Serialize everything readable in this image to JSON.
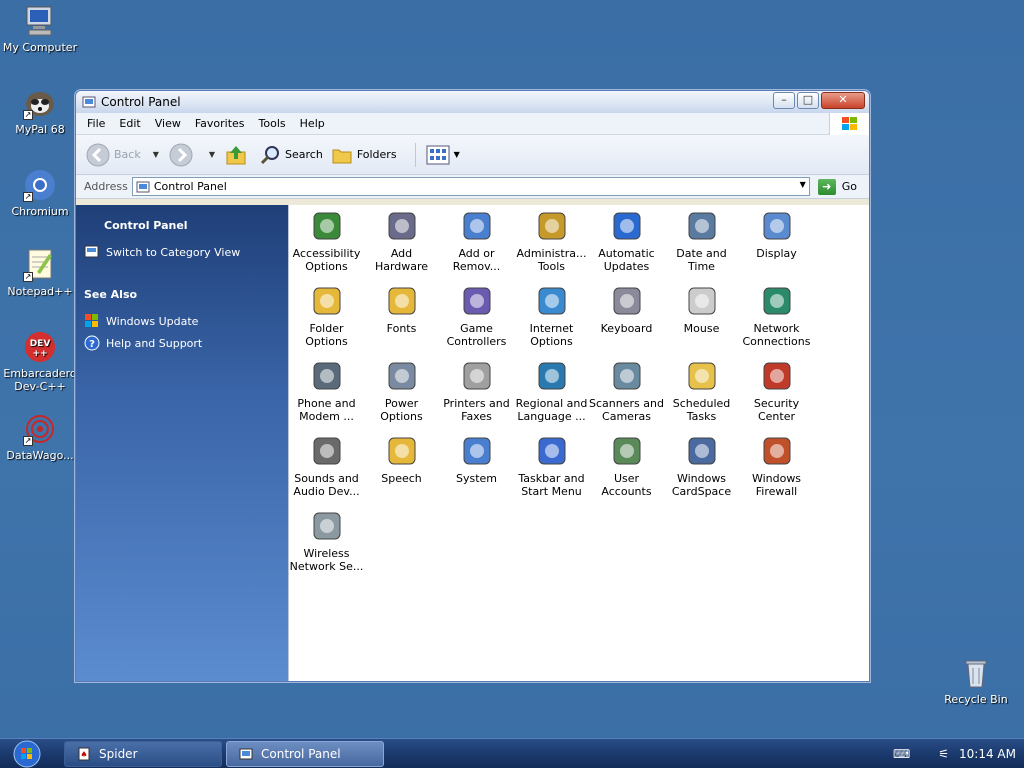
{
  "desktop": {
    "icons": [
      {
        "label": "My Computer",
        "icon": "my-computer-icon"
      },
      {
        "label": "MyPal 68",
        "icon": "mypal-icon"
      },
      {
        "label": "Chromium",
        "icon": "chromium-icon"
      },
      {
        "label": "Notepad++",
        "icon": "notepadpp-icon"
      },
      {
        "label": "Embarcadero Dev-C++",
        "icon": "devcpp-icon"
      },
      {
        "label": "DataWago...",
        "icon": "datawago-icon"
      },
      {
        "label": "Recycle Bin",
        "icon": "recycle-bin-icon"
      }
    ]
  },
  "window": {
    "title": "Control Panel",
    "menu": [
      "File",
      "Edit",
      "View",
      "Favorites",
      "Tools",
      "Help"
    ],
    "toolbar": {
      "back": "Back",
      "search": "Search",
      "folders": "Folders"
    },
    "address": {
      "label": "Address",
      "value": "Control Panel",
      "go": "Go"
    },
    "sidepanel": {
      "header": "Control Panel",
      "switch_view": "Switch to Category View",
      "see_also": "See Also",
      "links": [
        "Windows Update",
        "Help and Support"
      ]
    },
    "items": [
      {
        "label": "Accessibility Options",
        "icon": "accessibility-icon"
      },
      {
        "label": "Add Hardware",
        "icon": "add-hardware-icon"
      },
      {
        "label": "Add or Remov...",
        "icon": "add-remove-icon"
      },
      {
        "label": "Administra... Tools",
        "icon": "admin-tools-icon"
      },
      {
        "label": "Automatic Updates",
        "icon": "automatic-updates-icon"
      },
      {
        "label": "Date and Time",
        "icon": "date-time-icon"
      },
      {
        "label": "Display",
        "icon": "display-icon"
      },
      {
        "label": "Folder Options",
        "icon": "folder-options-icon"
      },
      {
        "label": "Fonts",
        "icon": "fonts-icon"
      },
      {
        "label": "Game Controllers",
        "icon": "game-controllers-icon"
      },
      {
        "label": "Internet Options",
        "icon": "internet-options-icon"
      },
      {
        "label": "Keyboard",
        "icon": "keyboard-icon"
      },
      {
        "label": "Mouse",
        "icon": "mouse-icon"
      },
      {
        "label": "Network Connections",
        "icon": "network-connections-icon"
      },
      {
        "label": "Phone and Modem ...",
        "icon": "phone-modem-icon"
      },
      {
        "label": "Power Options",
        "icon": "power-options-icon"
      },
      {
        "label": "Printers and Faxes",
        "icon": "printers-faxes-icon"
      },
      {
        "label": "Regional and Language ...",
        "icon": "regional-language-icon"
      },
      {
        "label": "Scanners and Cameras",
        "icon": "scanners-cameras-icon"
      },
      {
        "label": "Scheduled Tasks",
        "icon": "scheduled-tasks-icon"
      },
      {
        "label": "Security Center",
        "icon": "security-center-icon"
      },
      {
        "label": "Sounds and Audio Dev...",
        "icon": "sounds-audio-icon"
      },
      {
        "label": "Speech",
        "icon": "speech-icon"
      },
      {
        "label": "System",
        "icon": "system-icon"
      },
      {
        "label": "Taskbar and Start Menu",
        "icon": "taskbar-start-icon"
      },
      {
        "label": "User Accounts",
        "icon": "user-accounts-icon"
      },
      {
        "label": "Windows CardSpace",
        "icon": "cardspace-icon"
      },
      {
        "label": "Windows Firewall",
        "icon": "firewall-icon"
      },
      {
        "label": "Wireless Network Se...",
        "icon": "wireless-network-icon"
      }
    ]
  },
  "taskbar": {
    "buttons": [
      "Spider",
      "Control Panel"
    ],
    "clock": "10:14 AM"
  }
}
